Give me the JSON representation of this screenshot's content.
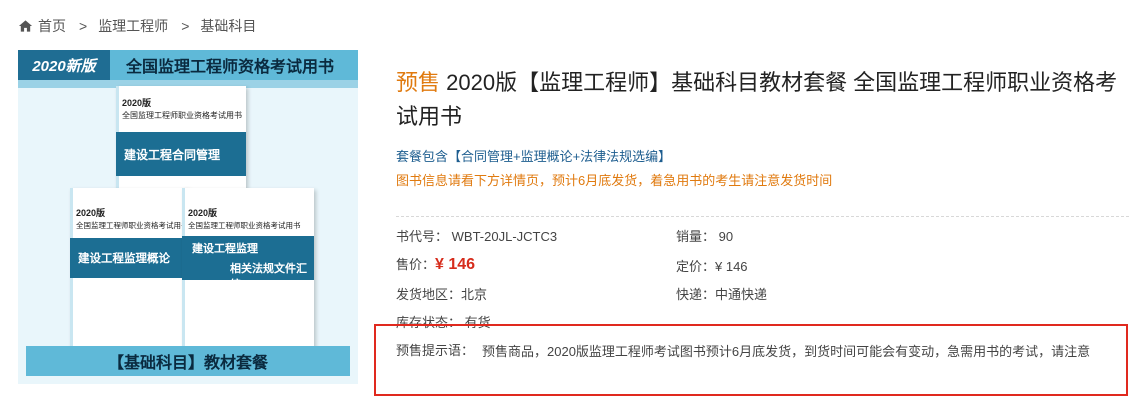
{
  "breadcrumb": {
    "home": "首页",
    "sep": ">",
    "level1": "监理工程师",
    "level2": "基础科目"
  },
  "cover": {
    "new_tag": "2020新版",
    "tagline": "全国监理工程师资格考试用书",
    "books": [
      {
        "year": "2020版",
        "series": "全国监理工程师职业资格考试用书",
        "title": "建设工程合同管理",
        "subtitle": ""
      },
      {
        "year": "2020版",
        "series": "全国监理工程师职业资格考试用书",
        "title": "建设工程监理概论",
        "subtitle": ""
      },
      {
        "year": "2020版",
        "series": "全国监理工程师职业资格考试用书",
        "title": "建设工程监理",
        "subtitle": "相关法规文件汇编"
      }
    ],
    "footer": "【基础科目】教材套餐"
  },
  "product": {
    "presale_tag": "预售",
    "title": " 2020版【监理工程师】基础科目教材套餐 全国监理工程师职业资格考试用书",
    "package": "套餐包含【合同管理+监理概论+法律法规选编】",
    "notice": "图书信息请看下方详情页，预计6月底发货，着急用书的考生请注意发货时间"
  },
  "attrs": {
    "code_label": "书代号：",
    "code_value": "WBT-20JL-JCTC3",
    "sales_label": "销量：",
    "sales_value": "90",
    "price_label": "售价：",
    "price_value": "¥ 146",
    "list_price": "定价：¥ 146",
    "region_label": "发货地区：",
    "region_value": "北京",
    "express_label": "快递：",
    "express_value": "中通快递",
    "stock_label": "库存状态：",
    "stock_value": "有货"
  },
  "tip": {
    "label": "预售提示语：",
    "text": "预售商品，2020版监理工程师考试图书预计6月底发货，到货时间可能会有变动，急需用书的考试，请注意"
  },
  "colors": {
    "presale": "#e07a0f",
    "price": "#d62c1c",
    "link": "#1d5d8f",
    "tip_border": "#e0291e"
  }
}
